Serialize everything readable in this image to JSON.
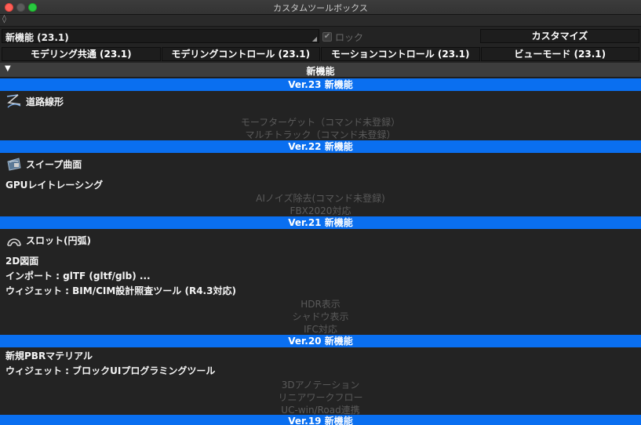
{
  "window": {
    "title": "カスタムツールボックス"
  },
  "toolbar": {
    "dropdown_value": "新機能 (23.1)",
    "lock_label": "ロック",
    "customize_label": "カスタマイズ"
  },
  "tabs": [
    {
      "label": "モデリング共通 (23.1)"
    },
    {
      "label": "モデリングコントロール (23.1)"
    },
    {
      "label": "モーションコントロール (23.1)"
    },
    {
      "label": "ビューモード (23.1)"
    }
  ],
  "section": {
    "title": "新機能"
  },
  "groups": [
    {
      "header": "Ver.23 新機能",
      "items": [
        {
          "label": "道路線形",
          "icon": "road-alignment-icon"
        }
      ],
      "disabled": [
        "モーフターゲット（コマンド未登録）",
        "マルチトラック（コマンド未登録）"
      ]
    },
    {
      "header": "Ver.22 新機能",
      "items": [
        {
          "label": "スイープ曲面",
          "icon": "sweep-surface-icon"
        },
        {
          "label": "GPUレイトレーシング"
        }
      ],
      "disabled": [
        "AIノイズ除去(コマンド未登録)",
        "FBX2020対応"
      ]
    },
    {
      "header": "Ver.21 新機能",
      "items": [
        {
          "label": "スロット(円弧)",
          "icon": "slot-arc-icon"
        },
        {
          "label": "2D図面"
        },
        {
          "label": "インポート : glTF (gltf/glb) ..."
        },
        {
          "label": "ウィジェット : BIM/CIM設計照査ツール (R4.3対応)"
        }
      ],
      "disabled": [
        "HDR表示",
        "シャドウ表示",
        "IFC対応"
      ]
    },
    {
      "header": "Ver.20 新機能",
      "items": [
        {
          "label": "新規PBRマテリアル"
        },
        {
          "label": "ウィジェット : ブロックUIプログラミングツール"
        }
      ],
      "disabled": [
        "3Dアノテーション",
        "リニアワークフロー",
        "UC-win/Road連携"
      ]
    },
    {
      "header": "Ver.19 新機能",
      "items": [],
      "disabled": []
    }
  ],
  "colors": {
    "version_header": "#0a6ff0",
    "disabled_text": "#5a5a5a",
    "background": "#232323"
  }
}
